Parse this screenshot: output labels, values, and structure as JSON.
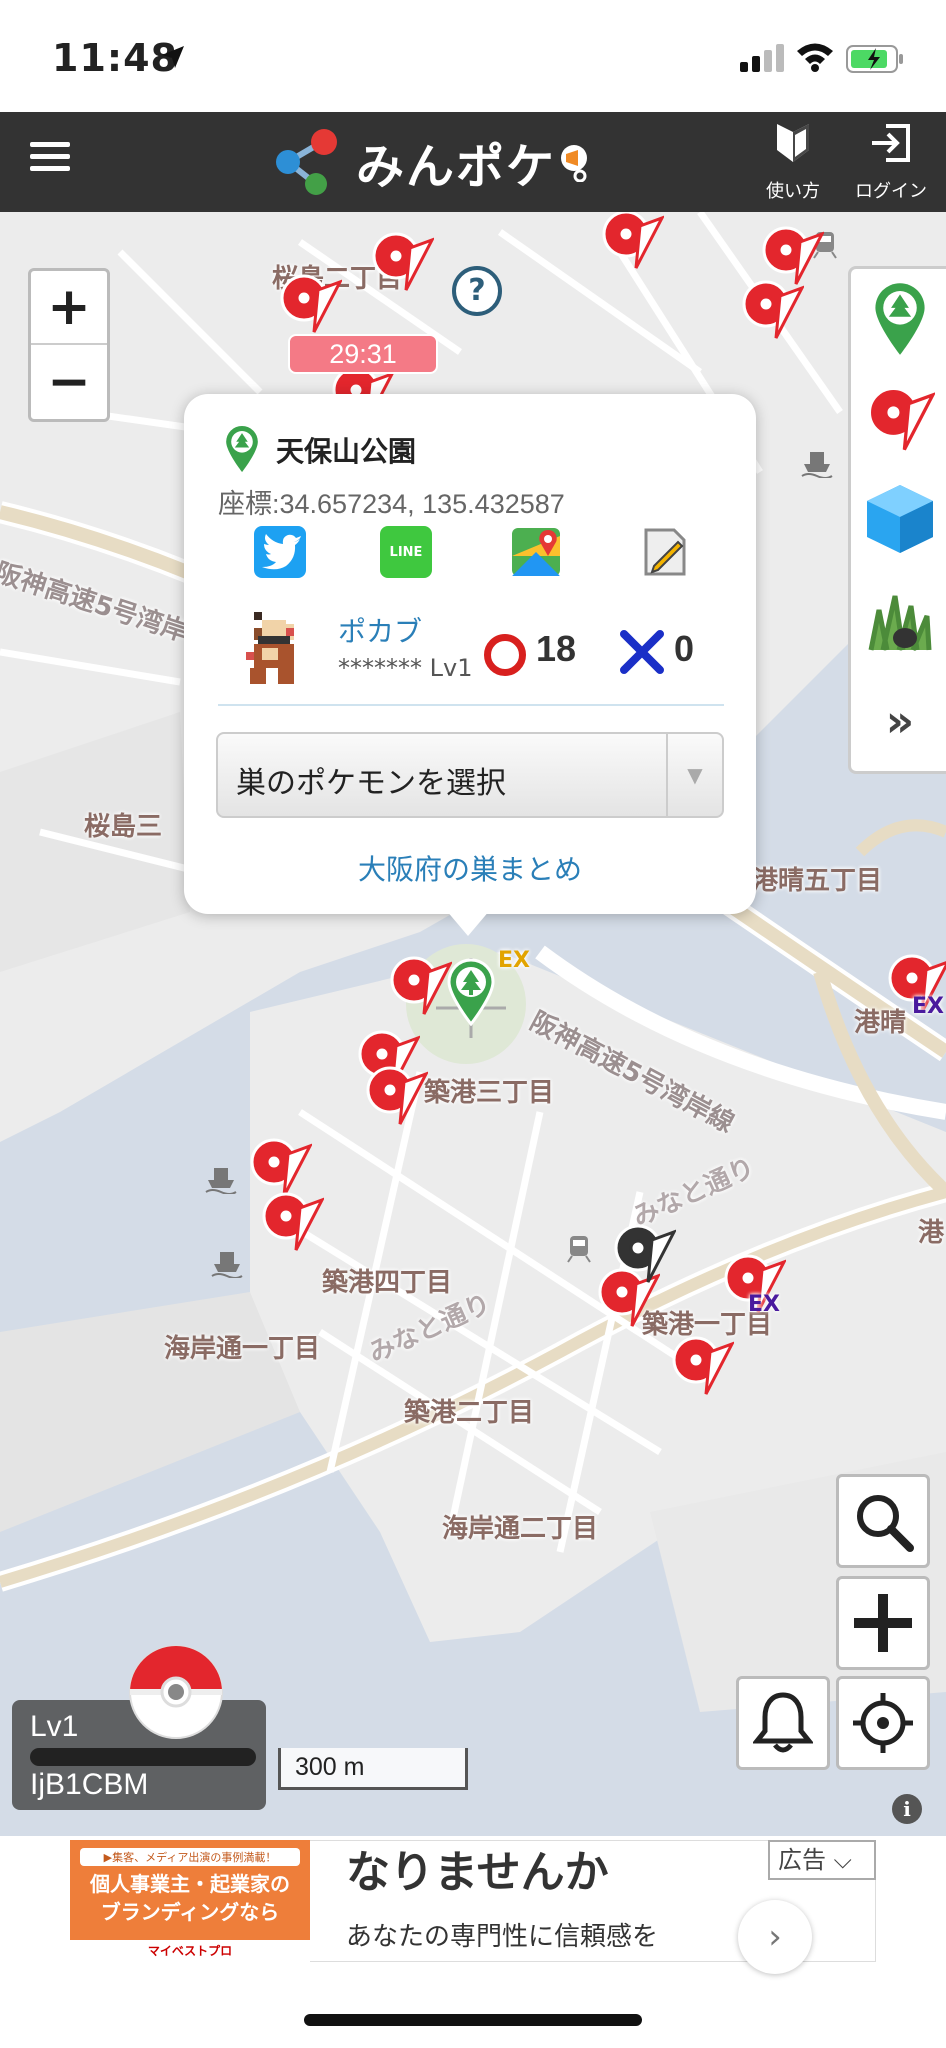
{
  "status_bar": {
    "time": "11:48"
  },
  "header": {
    "logo_text": "みんポケ",
    "howto_label": "使い方",
    "login_label": "ログイン"
  },
  "map": {
    "labels": {
      "sakurajima2": "桜島二丁目",
      "sakurajima3": "桜島三",
      "minatoharu5": "港晴五丁目",
      "minatoharu": "港晴",
      "expressway1": "阪神高速5号湾岸",
      "expressway2": "阪神高速5号湾岸線",
      "chikko3": "築港三丁目",
      "chikko4": "築港四丁目",
      "chikko2": "築港二丁目",
      "chikko1": "築港一丁目",
      "kaigan1": "海岸通一丁目",
      "kaigan2": "海岸通二丁目",
      "minato_dori1": "みなと通り",
      "minato_dori2": "みなと通り",
      "minato_right": "港",
      "ex1": "EX",
      "ex2": "EX",
      "ex3": "EX"
    },
    "timer": "29:31",
    "scale": "300 m"
  },
  "popup": {
    "title": "天保山公園",
    "coordinates": "座標:34.657234, 135.432587",
    "line_label": "LINE",
    "pokemon_name": "ポカブ",
    "pokemon_user": "******* Lv1",
    "good_count": "18",
    "bad_count": "0",
    "select_label": "巣のポケモンを選択",
    "summary_link": "大阪府の巣まとめ"
  },
  "player": {
    "level": "Lv1",
    "id": "IjB1CBM",
    "xp_progress": 0
  },
  "ad": {
    "image_top": "▶集客、メディア出演の事例満載！",
    "image_main_1": "個人事業主・起業家の",
    "image_main_2": "ブランディングなら",
    "image_brand": "マイベストプロ",
    "headline": "なりませんか",
    "body": "あなたの専門性に信頼感を",
    "label": "広告 ⌵"
  },
  "colors": {
    "header_bg": "#333333",
    "map_water": "#d4dce7",
    "map_land": "#ececec",
    "link": "#2a7fb8",
    "pin_red": "#e3262d",
    "pin_green": "#3aa24b",
    "timer_bg": "#f47a86"
  }
}
